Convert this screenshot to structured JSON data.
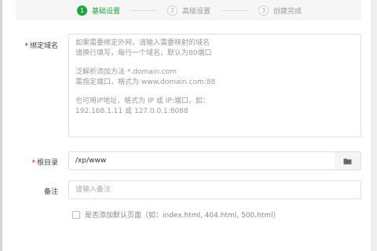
{
  "steps": [
    {
      "number": "1",
      "label": "基础设置"
    },
    {
      "number": "2",
      "label": "高级设置"
    },
    {
      "number": "3",
      "label": "创建完成"
    }
  ],
  "form": {
    "domain": {
      "required_mark": "*",
      "label": "绑定域名",
      "placeholder_lines": [
        "如果需要绑定外网，请输入需要映射的域名",
        "请换行填写，每行一个域名，默认为80端口",
        "",
        "泛解析添加方法 *.domain.com",
        "需指定端口，格式为 www.domain.com:88",
        "",
        "也可用IP地址，格式为 IP 或 IP:端口，如：",
        "192.168.1.11 或 127.0.0.1:8088"
      ]
    },
    "root_dir": {
      "required_mark": "*",
      "label": "根目录",
      "value": "/xp/www",
      "button_icon": "folder-icon"
    },
    "remark": {
      "label": "备注",
      "placeholder": "请输入备注"
    },
    "default_page": {
      "checked": false,
      "label": "是否添加默认页面（如：index.html, 404.html, 500.html）"
    }
  },
  "colors": {
    "accent": "#20a53a",
    "required": "#ef0808",
    "border": "#dcdfe6"
  }
}
